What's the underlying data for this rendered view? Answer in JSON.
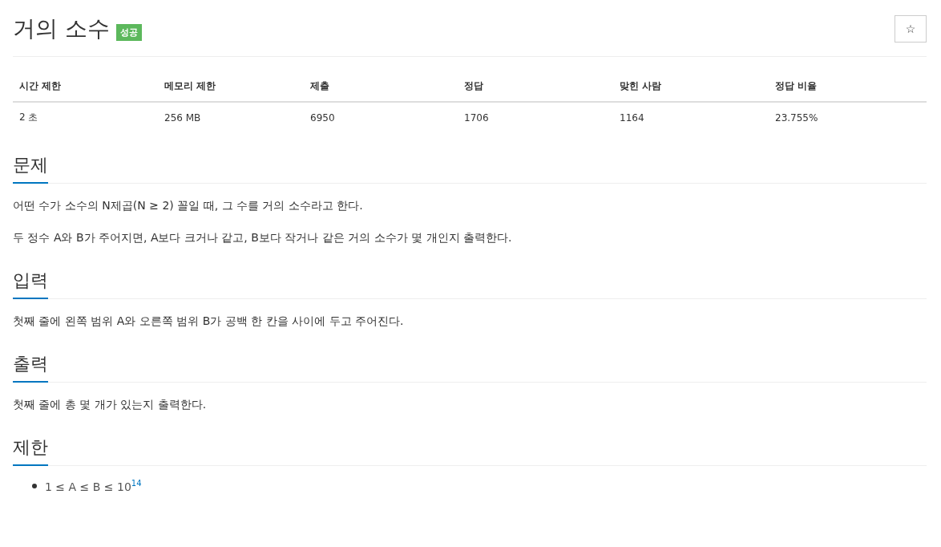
{
  "title": "거의 소수",
  "badge": {
    "label": "성공",
    "kind": "success"
  },
  "star_button": {
    "label": "☆"
  },
  "info_table": {
    "columns": [
      "시간 제한",
      "메모리 제한",
      "제출",
      "정답",
      "맞힌 사람",
      "정답 비율"
    ],
    "rows": [
      [
        "2 초",
        "256 MB",
        "6950",
        "1706",
        "1164",
        "23.755%"
      ]
    ]
  },
  "sections": [
    {
      "heading": "문제",
      "paragraphs": [
        "어떤 수가 소수의 N제곱(N ≥ 2) 꼴일 때, 그 수를 거의 소수라고 한다.",
        "두 정수 A와 B가 주어지면, A보다 크거나 같고, B보다 작거나 같은 거의 소수가 몇 개인지 출력한다."
      ]
    },
    {
      "heading": "입력",
      "paragraphs": [
        "첫째 줄에 왼쪽 범위 A와 오른쪽 범위 B가 공백 한 칸을 사이에 두고 주어진다."
      ]
    },
    {
      "heading": "출력",
      "paragraphs": [
        "첫째 줄에 총 몇 개가 있는지 출력한다."
      ]
    },
    {
      "heading": "제한",
      "bullets": [
        "1 ≤ A ≤ B ≤ 10$^{14}$"
      ]
    }
  ]
}
